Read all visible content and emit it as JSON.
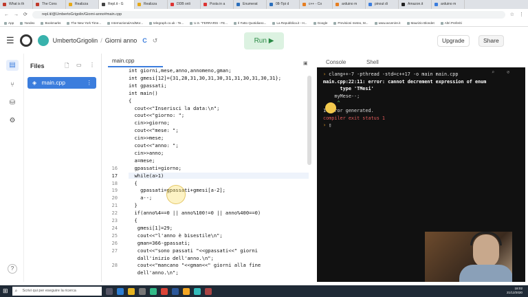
{
  "browser": {
    "tabs": [
      {
        "label": "What is th",
        "c": "#c0392b"
      },
      {
        "label": "The Cons",
        "c": "#c0392b"
      },
      {
        "label": "Realizza",
        "c": "#e6a817"
      },
      {
        "label": "Repl.it - G",
        "c": "#444"
      },
      {
        "label": "Realizza",
        "c": "#e6a817"
      },
      {
        "label": "DDB onli",
        "c": "#d33"
      },
      {
        "label": "Posta in a",
        "c": "#d33"
      },
      {
        "label": "Enumerat",
        "c": "#2c6fbb"
      },
      {
        "label": "08-Tipi d",
        "c": "#2c6fbb"
      },
      {
        "label": "c++ - Co",
        "c": "#e67e22"
      },
      {
        "label": "arduino m",
        "c": "#e67e22"
      },
      {
        "label": "pinout di",
        "c": "#3b7ddd"
      },
      {
        "label": "Amazon.it",
        "c": "#222"
      },
      {
        "label": "arduino m",
        "c": "#3b7ddd"
      }
    ],
    "url": "repl.it/@UmbertoGrigolin/Giorni-anno#main.cpp",
    "bookmarks": [
      "App",
      "Yandex",
      "Bookmarks",
      "The New York Time...",
      "InternazionalAndMor...",
      "telegraph.co.uk - Te...",
      "U.S. \"FERRARIS - FE...",
      "Il Fatto Quotidiano...",
      "La Repubblica.it - H...",
      "Google",
      "Previsioni meteo, M...",
      "www.avvenire.it",
      "Maurizio Blondet",
      "Altri Preferiti"
    ]
  },
  "app": {
    "user": "UmbertoGrigolin",
    "sep": "/",
    "project": "Giorni anno",
    "run": "Run ▶",
    "upgrade": "Upgrade",
    "share": "Share"
  },
  "files": {
    "title": "Files",
    "items": [
      {
        "name": "main.cpp"
      }
    ]
  },
  "editor": {
    "tab": "main.cpp",
    "lines": [
      {
        "n": "",
        "t": "int giorni,mese,anno,annomeno,gman;"
      },
      {
        "n": "",
        "t": "int gmesi[12]={31,28,31,30,31,30,31,31,30,31,30,31};"
      },
      {
        "n": "",
        "t": "int gpassati;"
      },
      {
        "n": "",
        "t": "int main()"
      },
      {
        "n": "",
        "t": "{"
      },
      {
        "n": "",
        "t": "  cout<<\"Inserisci la data:\\n\";"
      },
      {
        "n": "",
        "t": "  cout<<\"giorno: \";"
      },
      {
        "n": "",
        "t": "  cin>>giorno;"
      },
      {
        "n": "",
        "t": "  cout<<\"mese: \";"
      },
      {
        "n": "",
        "t": "  cin>>mese;"
      },
      {
        "n": "",
        "t": "  cout<<\"anno: \";"
      },
      {
        "n": "",
        "t": "  cin>>anno;"
      },
      {
        "n": "",
        "t": "  a=mese;"
      },
      {
        "n": "16",
        "t": "  gpassati=giorno;"
      },
      {
        "n": "17",
        "t": "  while(a>1)"
      },
      {
        "n": "18",
        "t": "  {"
      },
      {
        "n": "19",
        "t": "    gpassati=gpassati+gmesi[a-2];"
      },
      {
        "n": "20",
        "t": "    a--;"
      },
      {
        "n": "21",
        "t": "  }"
      },
      {
        "n": "22",
        "t": "  if(anno%4==0 || anno%100!=0 || anno%400==0)"
      },
      {
        "n": "23",
        "t": "  {"
      },
      {
        "n": "24",
        "t": "   gmesi[1]=29;"
      },
      {
        "n": "25",
        "t": "   cout<<\"l'anno è bisestile\\n\";"
      },
      {
        "n": "26",
        "t": "   gman=366-gpassati;"
      },
      {
        "n": "27",
        "t": "   cout<<\"sono passati \"<<gpassati<<\" giorni"
      },
      {
        "n": "",
        "t": "   dall'inizio dell'anno.\\n\";"
      },
      {
        "n": "28",
        "t": "   cout<<\"mancano \"<<gman<<\" giorni alla fine"
      },
      {
        "n": "",
        "t": "   dell'anno.\\n\";"
      }
    ]
  },
  "console": {
    "tab_console": "Console",
    "tab_shell": "Shell",
    "lines": [
      {
        "p": "›",
        "t": " clang++-7 -pthread -std=c++17 -o main main.cpp",
        "c": "#e6e6e6"
      },
      {
        "p": "",
        "t": "main.cpp:22:11: error: cannot decrement expression of enum",
        "c": "#ffffff"
      },
      {
        "p": "",
        "t": "      type 'TMesi'",
        "c": "#ffffff"
      },
      {
        "p": "",
        "t": "    myMese--;",
        "c": "#dcdcdc"
      },
      {
        "p": "",
        "t": "     ^",
        "c": "#6cd36c"
      },
      {
        "p": "",
        "t": "1 error generated.",
        "c": "#dcdcdc"
      },
      {
        "p": "",
        "t": "compiler exit status 1",
        "c": "#e05a5a"
      },
      {
        "p": "›",
        "t": " ▯",
        "c": "#e6e6e6"
      }
    ]
  },
  "taskbar": {
    "search": "Scrivi qui per eseguire la ricerca",
    "time": "18:02",
    "date": "21/12/2020"
  }
}
